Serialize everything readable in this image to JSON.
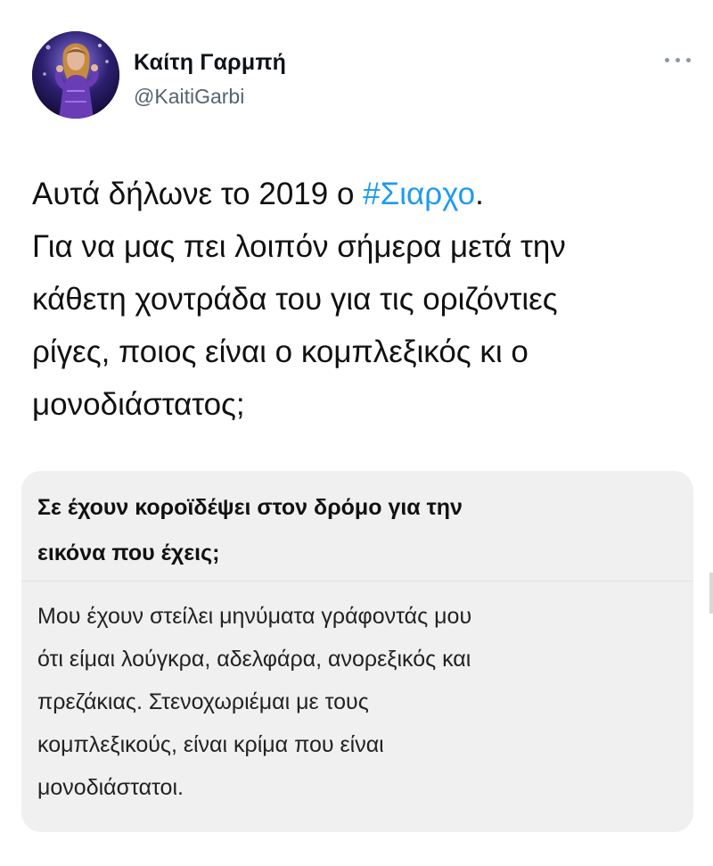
{
  "author": {
    "display_name": "Καίτη Γαρμπή",
    "handle": "@KaitiGarbi",
    "avatar_description": "profile-photo"
  },
  "tweet": {
    "lines": [
      "Αυτά δήλωνε το 2019 ο ",
      "Για να μας πει λοιπόν σήμερα μετά την",
      "κάθετη χοντράδα του για τις οριζόντιες",
      "ρίγες, ποιος είναι ο κομπλεξικός κι ο",
      "μονοδιάστατος;"
    ],
    "hashtag": "#Σιαρχο",
    "after_hashtag": "."
  },
  "quote": {
    "title_lines": [
      "Σε έχουν κοροϊδέψει στον δρόμο για την",
      "εικόνα που έχεις;"
    ],
    "body_lines": [
      "Μου έχουν στείλει μηνύματα γράφοντάς μου",
      "ότι είμαι λούγκρα, αδελφάρα, ανορεξικός και",
      "πρεζάκιας. Στενοχωριέμαι με τους",
      "κομπλεξικούς, είναι κρίμα που είναι",
      "μονοδιάστατοι."
    ]
  },
  "colors": {
    "accent": "#1d9bf0",
    "handle": "#536471",
    "quote_background": "#f0f0f0"
  },
  "icons": {
    "more": "more-horizontal-icon"
  }
}
